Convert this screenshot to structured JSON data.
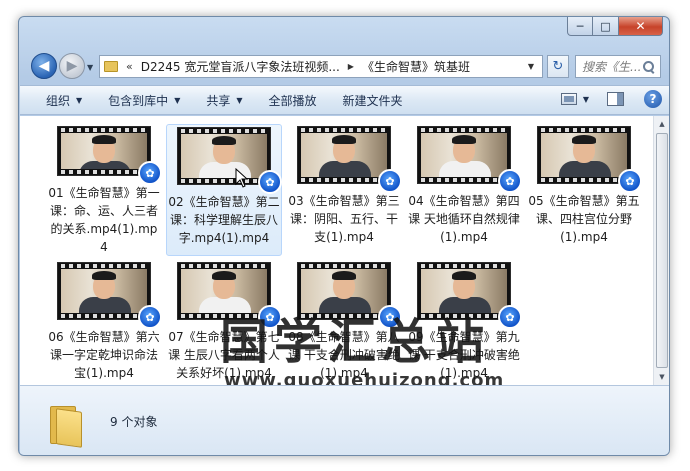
{
  "window": {
    "caption": {
      "minimize": "─",
      "maximize": "□",
      "close": "✕"
    }
  },
  "nav": {
    "back_icon": "◀",
    "forward_icon": "▶",
    "address_chevron": "«",
    "address_parts": [
      "D2245 宽元堂盲派八字象法班视频...",
      "《生命智慧》筑基班"
    ],
    "address_sep": "▶",
    "search_placeholder": "搜索《生...",
    "refresh_icon": "↻"
  },
  "toolbar": {
    "organize": "组织",
    "include_in_library": "包含到库中",
    "share": "共享",
    "play_all": "全部播放",
    "new_folder": "新建文件夹",
    "help": "?"
  },
  "files": [
    {
      "label": "01《生命智慧》第一课：命、运、人三者的关系.mp4(1).mp4",
      "shirt": "dark"
    },
    {
      "label": "02《生命智慧》第二课：科学理解生辰八字.mp4(1).mp4",
      "shirt": "white",
      "hover": true
    },
    {
      "label": "03《生命智慧》第三课：阴阳、五行、干支(1).mp4",
      "shirt": "dark"
    },
    {
      "label": "04《生命智慧》第四课 天地循环自然规律(1).mp4",
      "shirt": "white"
    },
    {
      "label": "05《生命智慧》第五课、四柱宫位分野(1).mp4",
      "shirt": "dark"
    },
    {
      "label": "06《生命智慧》第六课一字定乾坤识命法宝(1).mp4",
      "shirt": "dark"
    },
    {
      "label": "07《生命智慧》第七课 生辰八字看两个人关系好坏(1).mp4",
      "shirt": "white"
    },
    {
      "label": "08《生命智慧》第八课 干支合刑冲破害绝(1).mp4",
      "shirt": "dark"
    },
    {
      "label": "09《生命智慧》第九课 干支合刑冲破害绝(1).mp4",
      "shirt": "dark"
    }
  ],
  "details": {
    "count": "9 个对象"
  },
  "watermark": {
    "text": "国学汇总站",
    "url": "www.guoxuehuizong.com"
  }
}
